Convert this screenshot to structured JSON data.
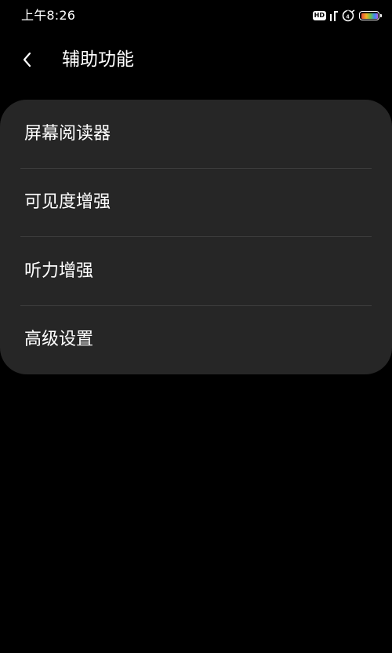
{
  "status_bar": {
    "time": "上午8:26",
    "hd_label": "HD",
    "icons": [
      "hd-icon",
      "signal-icon",
      "wifi-icon",
      "battery-icon"
    ]
  },
  "header": {
    "back_icon": "chevron-left-icon",
    "title": "辅助功能"
  },
  "menu": {
    "items": [
      {
        "label": "屏幕阅读器"
      },
      {
        "label": "可见度增强"
      },
      {
        "label": "听力增强"
      },
      {
        "label": "高级设置"
      }
    ]
  },
  "colors": {
    "background": "#000000",
    "card": "#262626",
    "divider": "#3d3d3d",
    "text": "#ffffff"
  }
}
